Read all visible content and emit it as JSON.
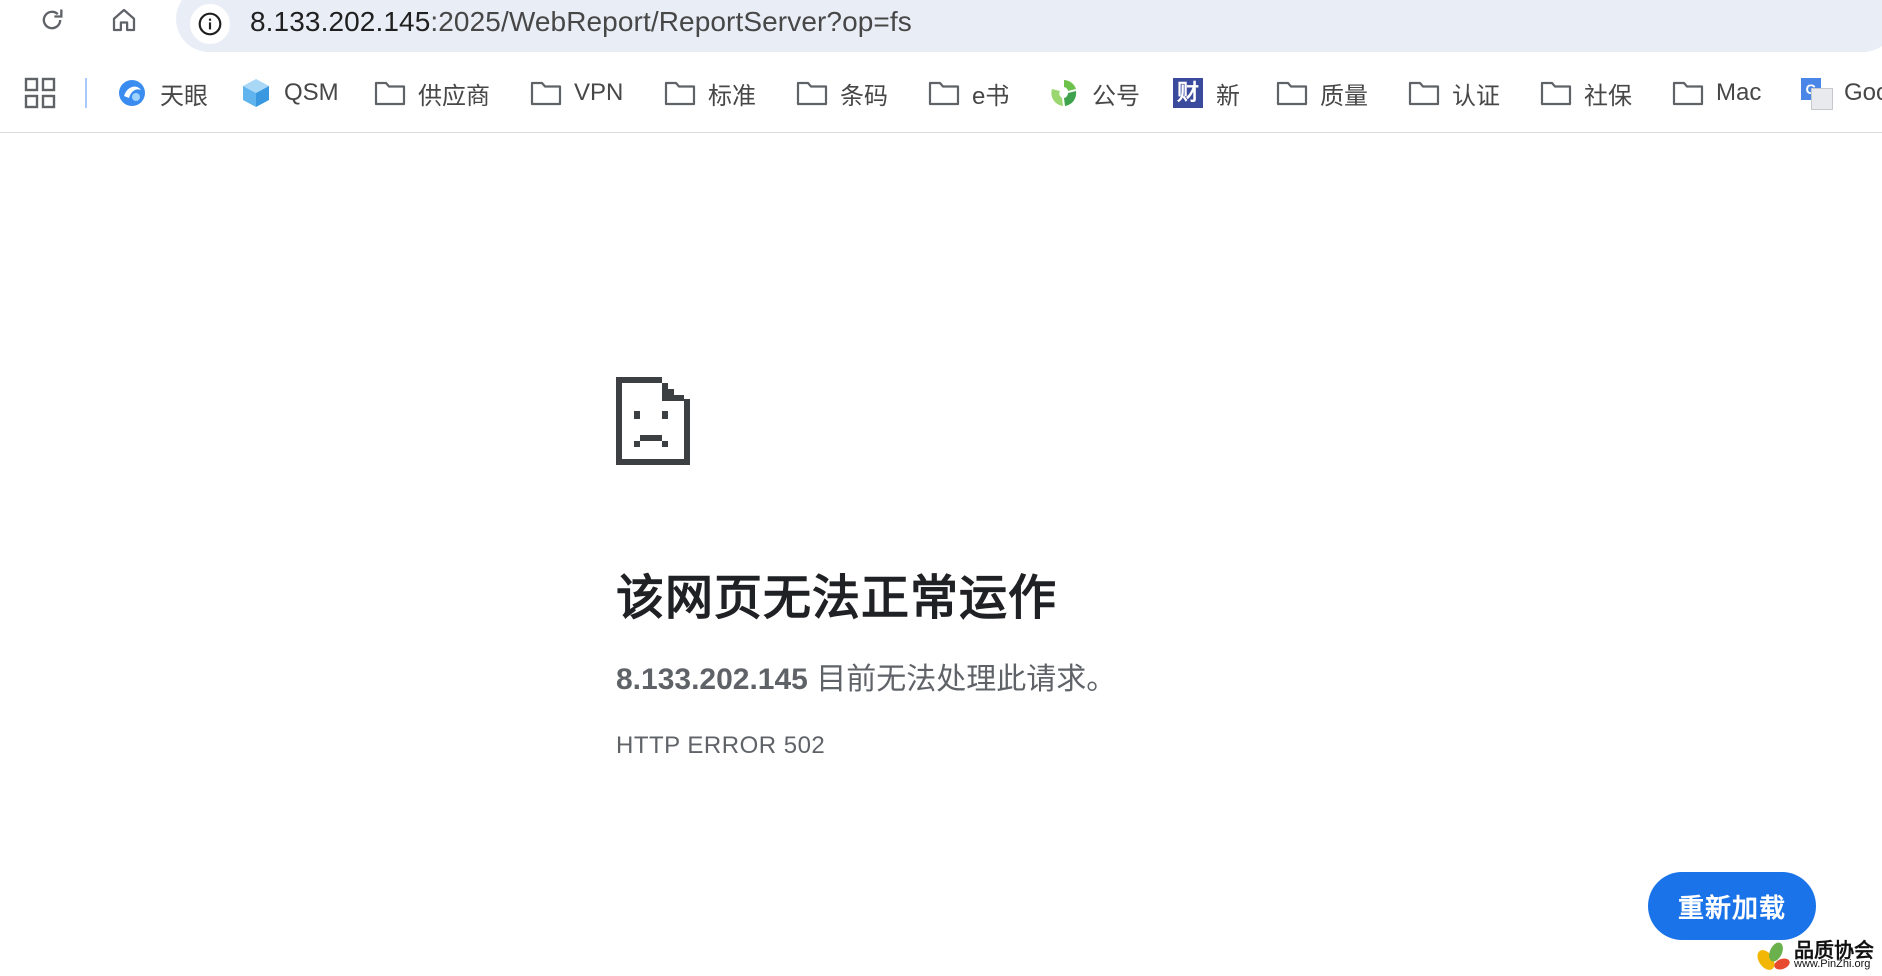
{
  "address_bar": {
    "url_host": "8.133.202.145",
    "url_rest": ":2025/WebReport/ReportServer?op=fs"
  },
  "bookmarks": [
    {
      "label": "天眼",
      "icon": "tianyan-logo-icon"
    },
    {
      "label": "QSM",
      "icon": "cube-icon"
    },
    {
      "label": "供应商",
      "icon": "folder-icon"
    },
    {
      "label": "VPN",
      "icon": "folder-icon"
    },
    {
      "label": "标准",
      "icon": "folder-icon"
    },
    {
      "label": "条码",
      "icon": "folder-icon"
    },
    {
      "label": "e书",
      "icon": "folder-icon"
    },
    {
      "label": "公号",
      "icon": "wechat-logo-icon"
    },
    {
      "label": "新",
      "icon": "cai-logo-icon",
      "icon_text": "财"
    },
    {
      "label": "质量",
      "icon": "folder-icon"
    },
    {
      "label": "认证",
      "icon": "folder-icon"
    },
    {
      "label": "社保",
      "icon": "folder-icon"
    },
    {
      "label": "Mac",
      "icon": "folder-icon"
    },
    {
      "label": "Goo",
      "icon": "google-translate-icon",
      "icon_text": "G"
    }
  ],
  "error": {
    "title": "该网页无法正常运作",
    "host": "8.133.202.145",
    "message": " 目前无法处理此请求。",
    "code": "HTTP ERROR 502",
    "reload_label": "重新加载"
  },
  "watermark": {
    "name": "品质协会",
    "url": "www.PinZhi.org"
  },
  "colors": {
    "accent": "#1a73e8",
    "omnibox_bg": "#e9eef6",
    "icon_gray": "#5f6368"
  }
}
